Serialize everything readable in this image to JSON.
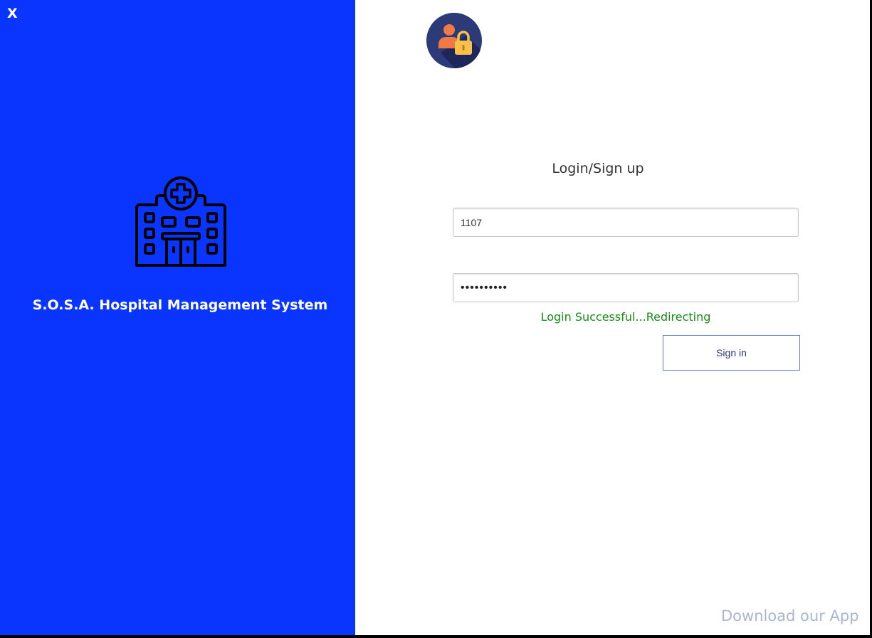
{
  "window": {
    "close_label": "X"
  },
  "brand": {
    "title": "S.O.S.A. Hospital Management System",
    "icon": "hospital-icon",
    "panel_color": "#0a35ff"
  },
  "login": {
    "avatar_icon": "user-lock-icon",
    "heading": "Login/Sign up",
    "user_id_value": "1107",
    "password_value": "••••••••••",
    "status_message": "Login Successful...Redirecting",
    "status_color": "#1a8c1a",
    "signin_label": "Sign in"
  },
  "footer": {
    "download_label": "Download our App"
  }
}
